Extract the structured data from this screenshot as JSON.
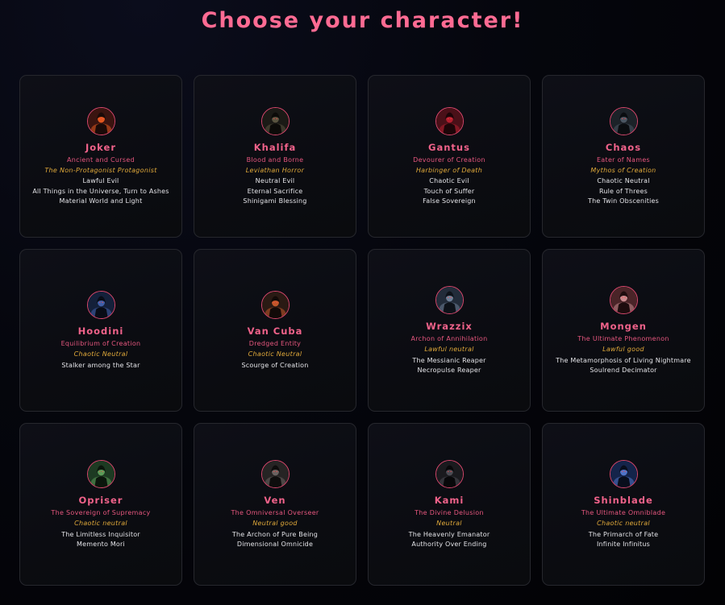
{
  "page_title": "Choose your character!",
  "colors": {
    "accent_pink": "#f0628a",
    "accent_gold": "#e0a93a",
    "text_light": "#e4e4e8",
    "background": "#05060d"
  },
  "characters": [
    {
      "name": "Joker",
      "title": "Ancient and Cursed",
      "class": "The Non-Protagonist Protagonist",
      "lines": [
        "Lawful Evil",
        "All Things in the Universe, Turn to Ashes",
        "Material World and Light"
      ],
      "avatar": {
        "icon": "fire-demon-portrait-icon",
        "bg": "#3a1410",
        "fg": "#e0571f",
        "accent": "#1a0a08"
      }
    },
    {
      "name": "Khalifa",
      "title": "Blood and Borne",
      "class": "Leviathan Horror",
      "lines": [
        "Neutral Evil",
        "Eternal Sacrifice",
        "Shinigami Blessing"
      ],
      "avatar": {
        "icon": "horned-warlord-portrait-icon",
        "bg": "#1b1a16",
        "fg": "#5a5440",
        "accent": "#0c0b09"
      }
    },
    {
      "name": "Gantus",
      "title": "Devourer of Creation",
      "class": "Harbinger of Death",
      "lines": [
        "Chaotic Evil",
        "Touch of Suffer",
        "False Sovereign"
      ],
      "avatar": {
        "icon": "crimson-reaper-portrait-icon",
        "bg": "#4a1018",
        "fg": "#b31e2e",
        "accent": "#1c0508"
      }
    },
    {
      "name": "Chaos",
      "title": "Eater of Names",
      "class": "Mythos of Creation",
      "lines": [
        "Chaotic Neutral",
        "Rule of Threes",
        "The Twin Obscenities"
      ],
      "avatar": {
        "icon": "shadow-knight-portrait-icon",
        "bg": "#1c2228",
        "fg": "#4b5662",
        "accent": "#0a0d10"
      }
    },
    {
      "name": "Hoodini",
      "title": "Equilibrium of Creation",
      "class": "Chaotic Neutral",
      "lines": [
        "Stalker among the Star"
      ],
      "avatar": {
        "icon": "hooded-mage-portrait-icon",
        "bg": "#14203a",
        "fg": "#3f5fa8",
        "accent": "#080c16"
      }
    },
    {
      "name": "Van Cuba",
      "title": "Dredged Entity",
      "class": "Chaotic Neutral",
      "lines": [
        "Scourge of Creation"
      ],
      "avatar": {
        "icon": "flame-wraith-portrait-icon",
        "bg": "#2a1a14",
        "fg": "#c2572a",
        "accent": "#120a08"
      }
    },
    {
      "name": "Wrazzix",
      "title": "Archon of Annihilation",
      "class": "Lawful neutral",
      "lines": [
        "The Messianic Reaper",
        "Necropulse Reaper"
      ],
      "avatar": {
        "icon": "armored-archon-portrait-icon",
        "bg": "#222c3a",
        "fg": "#6d7f96",
        "accent": "#0d1219"
      }
    },
    {
      "name": "Mongen",
      "title": "The Ultimate Phenomenon",
      "class": "Lawful good",
      "lines": [
        "The Metamorphosis of Living Nightmare",
        "Soulrend Decimator"
      ],
      "avatar": {
        "icon": "flesh-horror-portrait-icon",
        "bg": "#4a2428",
        "fg": "#c78a8e",
        "accent": "#1e0c0e"
      }
    },
    {
      "name": "Opriser",
      "title": "The Sovereign of Supremacy",
      "class": "Chaotic neutral",
      "lines": [
        "The Limitless Inquisitor",
        "Memento Mori"
      ],
      "avatar": {
        "icon": "forest-sovereign-portrait-icon",
        "bg": "#1d3a22",
        "fg": "#5b9a58",
        "accent": "#0b160c"
      }
    },
    {
      "name": "Ven",
      "title": "The Omniversal Overseer",
      "class": "Neutral good",
      "lines": [
        "The Archon of Pure Being",
        "Dimensional Omnicide"
      ],
      "avatar": {
        "icon": "veiled-overseer-portrait-icon",
        "bg": "#262424",
        "fg": "#6a6260",
        "accent": "#0e0d0d"
      }
    },
    {
      "name": "Kami",
      "title": "The Divine Delusion",
      "class": "Neutral",
      "lines": [
        "The Heavenly Emanator",
        "Authority Over Ending"
      ],
      "avatar": {
        "icon": "dark-deity-portrait-icon",
        "bg": "#1a1a1e",
        "fg": "#4a4a52",
        "accent": "#08080a"
      }
    },
    {
      "name": "Shinblade",
      "title": "The Ultimate Omniblade",
      "class": "Chaotic neutral",
      "lines": [
        "The Primarch of Fate",
        "Infinite Infinitus"
      ],
      "avatar": {
        "icon": "blue-swordsman-portrait-icon",
        "bg": "#14244a",
        "fg": "#4f74c8",
        "accent": "#080e1c"
      }
    }
  ]
}
